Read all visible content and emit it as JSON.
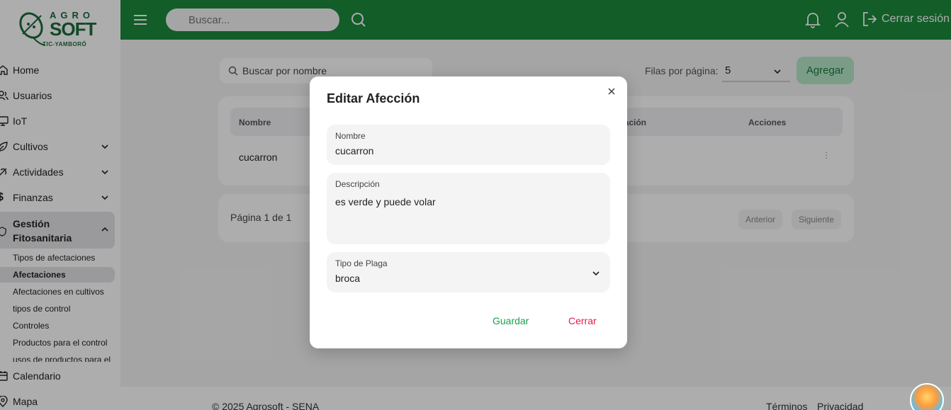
{
  "logo": {
    "top": "AGRO",
    "main": "SOFT",
    "sub": "TIC-YAMBORÓ"
  },
  "sidebar": {
    "items": [
      {
        "label": "Home",
        "icon": "home-icon"
      },
      {
        "label": "Usuarios",
        "icon": "users-icon"
      },
      {
        "label": "IoT",
        "icon": "monitor-icon"
      },
      {
        "label": "Cultivos",
        "icon": "leaf-icon"
      },
      {
        "label": "Actividades",
        "icon": "activity-icon"
      },
      {
        "label": "Finanzas",
        "icon": "dollar-icon"
      },
      {
        "label": "Gestión Fitosanitaria",
        "icon": "shield-icon"
      },
      {
        "label": "Calendario",
        "icon": "calendar-icon"
      },
      {
        "label": "Mapa",
        "icon": "map-pin-icon"
      }
    ],
    "subitems": [
      "Tipos de afectaciones",
      "Afectaciones",
      "Afectaciones en cultivos",
      "tipos de control",
      "Controles",
      "Productos para el control",
      "usos de productos para el"
    ]
  },
  "header": {
    "search_placeholder": "Buscar...",
    "logout_label": "Cerrar sesión"
  },
  "main": {
    "filter_placeholder": "Buscar por nombre",
    "rows_label": "Filas por página:",
    "rows_value": "5",
    "add_label": "Agregar",
    "columns": [
      "Nombre",
      "ctación",
      "Acciones"
    ],
    "rows": [
      {
        "nombre": "cucarron"
      }
    ],
    "row_actions": "⋮",
    "page_text": "Página 1 de 1",
    "prev_label": "Anterior",
    "next_label": "Siguiente"
  },
  "modal": {
    "title": "Editar Afección",
    "fields": {
      "nombre": {
        "label": "Nombre",
        "value": "cucarron"
      },
      "descripcion": {
        "label": "Descripción",
        "value": "es verde y puede volar"
      },
      "tipo_plaga": {
        "label": "Tipo de Plaga",
        "value": "broca"
      }
    },
    "save_label": "Guardar",
    "close_label": "Cerrar"
  },
  "footer": {
    "copyright": "© 2025 Agrosoft - SENA",
    "terms": "Términos",
    "privacy": "Privacidad"
  },
  "colors": {
    "header": "#1b8a3c",
    "save": "#17a34a",
    "close": "#e11d48"
  }
}
